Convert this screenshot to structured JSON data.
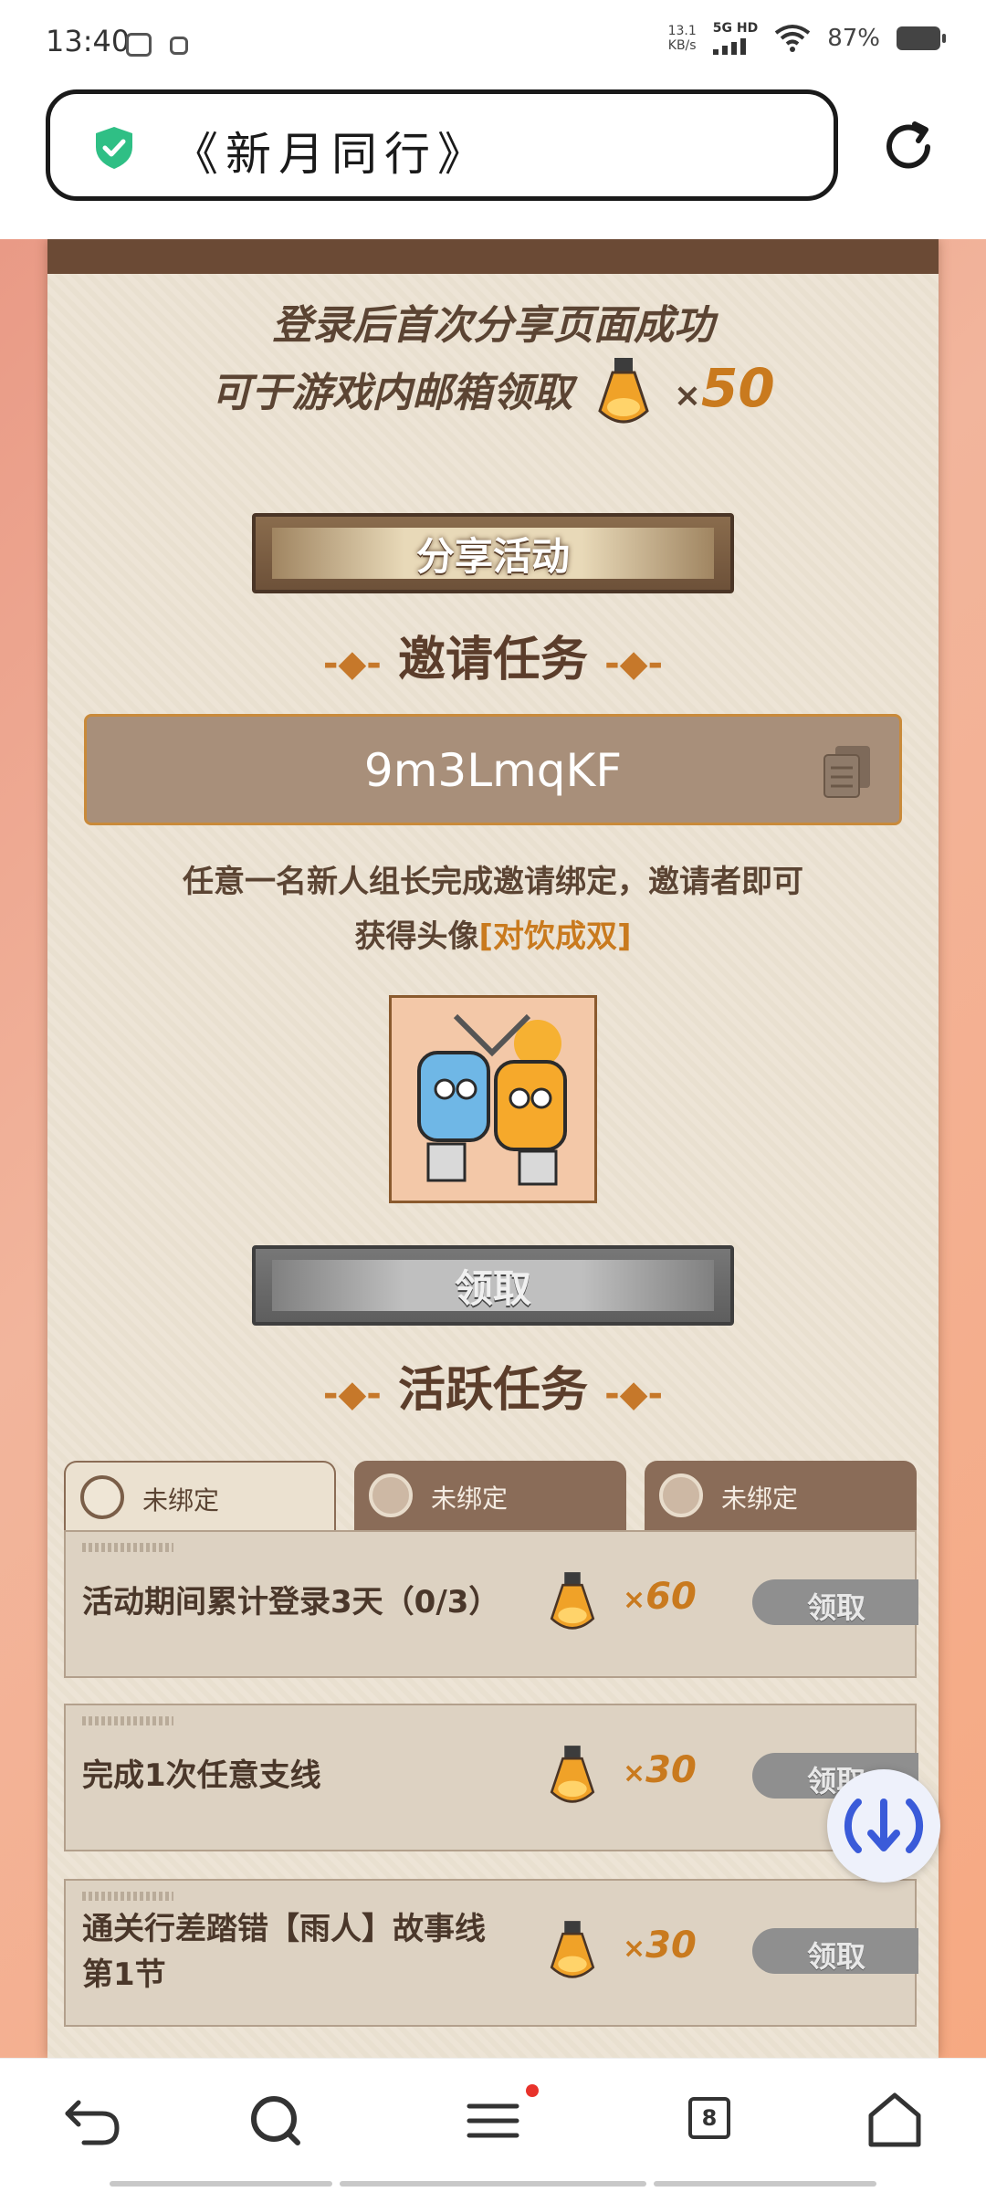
{
  "status_bar": {
    "time": "13:40",
    "net_speed_value": "13.1",
    "net_speed_unit": "KB/s",
    "network": "5G HD",
    "battery": "87%"
  },
  "address_bar": {
    "title": "《新月同行》"
  },
  "share_section": {
    "line1": "登录后首次分享页面成功",
    "line2": "可于游戏内邮箱领取",
    "reward_x": "×",
    "reward_count": "50",
    "button_label": "分享活动"
  },
  "invite_section": {
    "title": "邀请任务",
    "invite_code": "9m3LmqKF",
    "desc_line1": "任意一名新人组长完成邀请绑定，邀请者即可",
    "desc_line2_prefix": "获得头像",
    "desc_line2_highlight": "[对饮成双]",
    "claim_label": "领取"
  },
  "active_section": {
    "title": "活跃任务",
    "tabs": [
      {
        "label": "未绑定",
        "state": "active"
      },
      {
        "label": "未绑定",
        "state": "inactive"
      },
      {
        "label": "未绑定",
        "state": "inactive"
      }
    ],
    "tasks": [
      {
        "text": "活动期间累计登录3天（0/3）",
        "x": "×",
        "count": "60",
        "button": "领取"
      },
      {
        "text": "完成1次任意支线",
        "x": "×",
        "count": "30",
        "button": "领取"
      },
      {
        "text_line1": "通关行差踏错【雨人】故事线",
        "text_line2": "第1节",
        "x": "×",
        "count": "30",
        "button": "领取"
      }
    ]
  },
  "bottom_nav": {
    "tab_count": "8"
  },
  "colors": {
    "accent_orange": "#c97a1e",
    "paper": "#ede4d6",
    "dark_brown": "#5b3d2b",
    "shield_green": "#2fbf85",
    "fab_blue": "#3a5bd9"
  }
}
